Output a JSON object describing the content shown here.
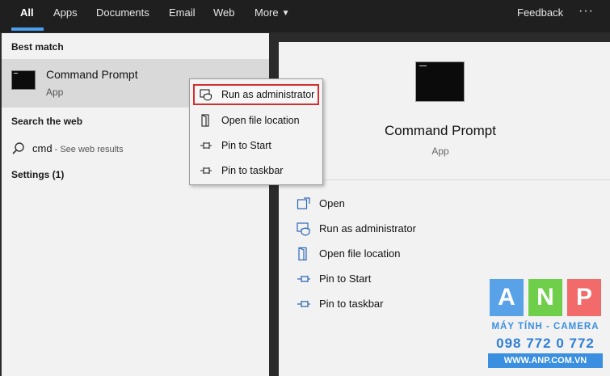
{
  "tabs": [
    {
      "label": "All",
      "active": true
    },
    {
      "label": "Apps"
    },
    {
      "label": "Documents"
    },
    {
      "label": "Email"
    },
    {
      "label": "Web"
    },
    {
      "label": "More",
      "icon": "chevron-down-icon"
    }
  ],
  "topbar": {
    "feedback_label": "Feedback",
    "more_options": "···"
  },
  "left": {
    "best_match_header": "Best match",
    "best_match": {
      "title": "Command Prompt",
      "subtitle": "App",
      "icon": "command-prompt-icon"
    },
    "search_web_header": "Search the web",
    "web_result": {
      "query": "cmd",
      "hint": " - See web results",
      "icon": "search-icon"
    },
    "settings_header": "Settings (1)"
  },
  "context_menu": {
    "items": [
      {
        "label": "Run as administrator",
        "icon": "shield-icon",
        "highlighted": true
      },
      {
        "label": "Open file location",
        "icon": "file-location-icon"
      },
      {
        "label": "Pin to Start",
        "icon": "pin-icon"
      },
      {
        "label": "Pin to taskbar",
        "icon": "pin-icon"
      }
    ]
  },
  "details": {
    "title": "Command Prompt",
    "subtitle": "App",
    "icon": "command-prompt-icon",
    "actions": [
      {
        "label": "Open",
        "icon": "open-icon"
      },
      {
        "label": "Run as administrator",
        "icon": "shield-icon"
      },
      {
        "label": "Open file location",
        "icon": "file-location-icon"
      },
      {
        "label": "Pin to Start",
        "icon": "pin-icon"
      },
      {
        "label": "Pin to taskbar",
        "icon": "pin-icon"
      }
    ]
  },
  "watermark": {
    "letters": [
      "A",
      "N",
      "P"
    ],
    "colors": [
      "#5aa2e8",
      "#6fcf4a",
      "#f26a6a"
    ],
    "line1": "MÁY TÍNH - CAMERA",
    "line2": "098 772 0 772",
    "line3": "WWW.ANP.COM.VN"
  },
  "colors": {
    "accent": "#4a9ff0",
    "highlight_border": "#d32f2f",
    "icon_blue": "#2a66b8"
  }
}
